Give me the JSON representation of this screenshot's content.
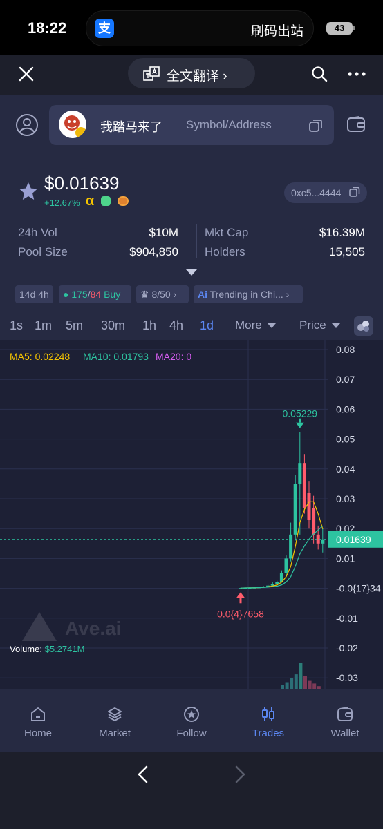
{
  "status_bar": {
    "time": "18:22",
    "pay_icon": "支",
    "pay_text": "刷码出站",
    "battery": "43"
  },
  "browser": {
    "translate_label": "全文翻译 ›"
  },
  "header": {
    "token_name": "我踏马来了",
    "search_placeholder": "Symbol/Address"
  },
  "token": {
    "price": "$0.01639",
    "change": "+12.67%",
    "alpha_mark": "α",
    "address": "0xc5...4444",
    "stats": {
      "vol_label": "24h Vol",
      "vol_value": "$10M",
      "pool_label": "Pool Size",
      "pool_value": "$904,850",
      "mcap_label": "Mkt Cap",
      "mcap_value": "$16.39M",
      "holders_label": "Holders",
      "holders_value": "15,505"
    },
    "chips": {
      "age": "14d 4h",
      "buys": "175",
      "sep": "/",
      "sells": "84",
      "buy_word": "Buy",
      "rank": "8/50 ›",
      "trending": "Trending in Chi... ›"
    }
  },
  "timeframes": [
    "1s",
    "1m",
    "5m",
    "30m",
    "1h",
    "4h",
    "1d"
  ],
  "active_timeframe": "1d",
  "dropdowns": {
    "more": "More",
    "price": "Price"
  },
  "chart_data": {
    "type": "candlestick",
    "ma": {
      "ma5": "MA5: 0.02248",
      "ma10": "MA10: 0.01793",
      "ma20": "MA20: 0"
    },
    "y_ticks": [
      "0.08",
      "0.07",
      "0.06",
      "0.05",
      "0.04",
      "0.03",
      "0.02",
      "0.01",
      "-0.0{17}34",
      "-0.01",
      "-0.02",
      "-0.03"
    ],
    "ylim": [
      -0.03,
      0.08
    ],
    "current_price": 0.01639,
    "current_price_label": "0.01639",
    "high_label": "0.05229",
    "high_value": 0.05229,
    "low_label": "0.0{4}7658",
    "low_value": 7.658e-05,
    "candles": [
      {
        "o": 0.0001,
        "h": 0.0002,
        "l": 7.658e-05,
        "c": 0.0001
      },
      {
        "o": 0.0001,
        "h": 0.0003,
        "l": 0.0001,
        "c": 0.0002
      },
      {
        "o": 0.0002,
        "h": 0.0004,
        "l": 0.0001,
        "c": 0.0002
      },
      {
        "o": 0.0002,
        "h": 0.0005,
        "l": 0.0001,
        "c": 0.0003
      },
      {
        "o": 0.0003,
        "h": 0.0006,
        "l": 0.0002,
        "c": 0.0004
      },
      {
        "o": 0.0004,
        "h": 0.0008,
        "l": 0.0003,
        "c": 0.0006
      },
      {
        "o": 0.0006,
        "h": 0.0012,
        "l": 0.0005,
        "c": 0.0009
      },
      {
        "o": 0.0009,
        "h": 0.002,
        "l": 0.0008,
        "c": 0.0015
      },
      {
        "o": 0.0015,
        "h": 0.0025,
        "l": 0.0012,
        "c": 0.0022
      },
      {
        "o": 0.0022,
        "h": 0.006,
        "l": 0.002,
        "c": 0.005
      },
      {
        "o": 0.005,
        "h": 0.011,
        "l": 0.0045,
        "c": 0.01
      },
      {
        "o": 0.01,
        "h": 0.022,
        "l": 0.009,
        "c": 0.018
      },
      {
        "o": 0.018,
        "h": 0.038,
        "l": 0.016,
        "c": 0.035
      },
      {
        "o": 0.035,
        "h": 0.05229,
        "l": 0.018,
        "c": 0.042
      },
      {
        "o": 0.042,
        "h": 0.045,
        "l": 0.025,
        "c": 0.027
      },
      {
        "o": 0.032,
        "h": 0.036,
        "l": 0.02,
        "c": 0.023
      },
      {
        "o": 0.027,
        "h": 0.031,
        "l": 0.015,
        "c": 0.018
      },
      {
        "o": 0.018,
        "h": 0.021,
        "l": 0.013,
        "c": 0.015
      },
      {
        "o": 0.015,
        "h": 0.02,
        "l": 0.012,
        "c": 0.01639
      }
    ],
    "volume_label": "Volume:",
    "volume_value": "$5.2741M",
    "volume_bars": [
      0.15,
      0.25,
      0.4,
      0.55,
      1.0,
      0.5,
      0.3,
      0.2,
      0.1
    ],
    "watermark": "Ave.ai"
  },
  "nav": [
    {
      "label": "Home",
      "icon": "home-icon"
    },
    {
      "label": "Market",
      "icon": "layers-icon"
    },
    {
      "label": "Follow",
      "icon": "star-circle-icon"
    },
    {
      "label": "Trades",
      "icon": "candles-icon"
    },
    {
      "label": "Wallet",
      "icon": "wallet-icon"
    }
  ],
  "active_nav": "Trades",
  "colors": {
    "up": "#2dc3a0",
    "down": "#ff5c6c",
    "accent": "#5b86f0",
    "ma5": "#f5c400",
    "ma10": "#2dc3a0",
    "ma20": "#d65cf0"
  }
}
